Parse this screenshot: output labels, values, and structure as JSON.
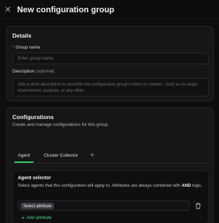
{
  "header": {
    "title": "New configuration group",
    "close_icon": "close-icon"
  },
  "details": {
    "title": "Details",
    "group_name_label": "Group name",
    "required_mark": "*",
    "group_name_placeholder": "Enter group name",
    "description_label": "Description",
    "description_optional": "(optional)",
    "description_placeholder": "Add a short description to describe the configuration group's intent or context - such as its target environment, purpose, or any other."
  },
  "configurations": {
    "title": "Configurations",
    "subtitle": "Create and manage configurations for this group.",
    "tabs": [
      {
        "label": "Agent",
        "active": true
      },
      {
        "label": "Cluster Collector",
        "active": false
      }
    ],
    "add_tab_symbol": "+",
    "agent_selector": {
      "title": "Agent selector",
      "description_prefix": "Select agents that this configuration will apply to. Attributes are always combined with ",
      "description_bold": "AND",
      "description_suffix": " logic.",
      "select_attribute_label": "Select attribute",
      "add_attribute_label": "Add attribute",
      "add_symbol": "+"
    }
  },
  "colors": {
    "accent": "#2fd06b",
    "required": "#e5484d",
    "background": "#0d0d0e",
    "card": "#161618"
  }
}
